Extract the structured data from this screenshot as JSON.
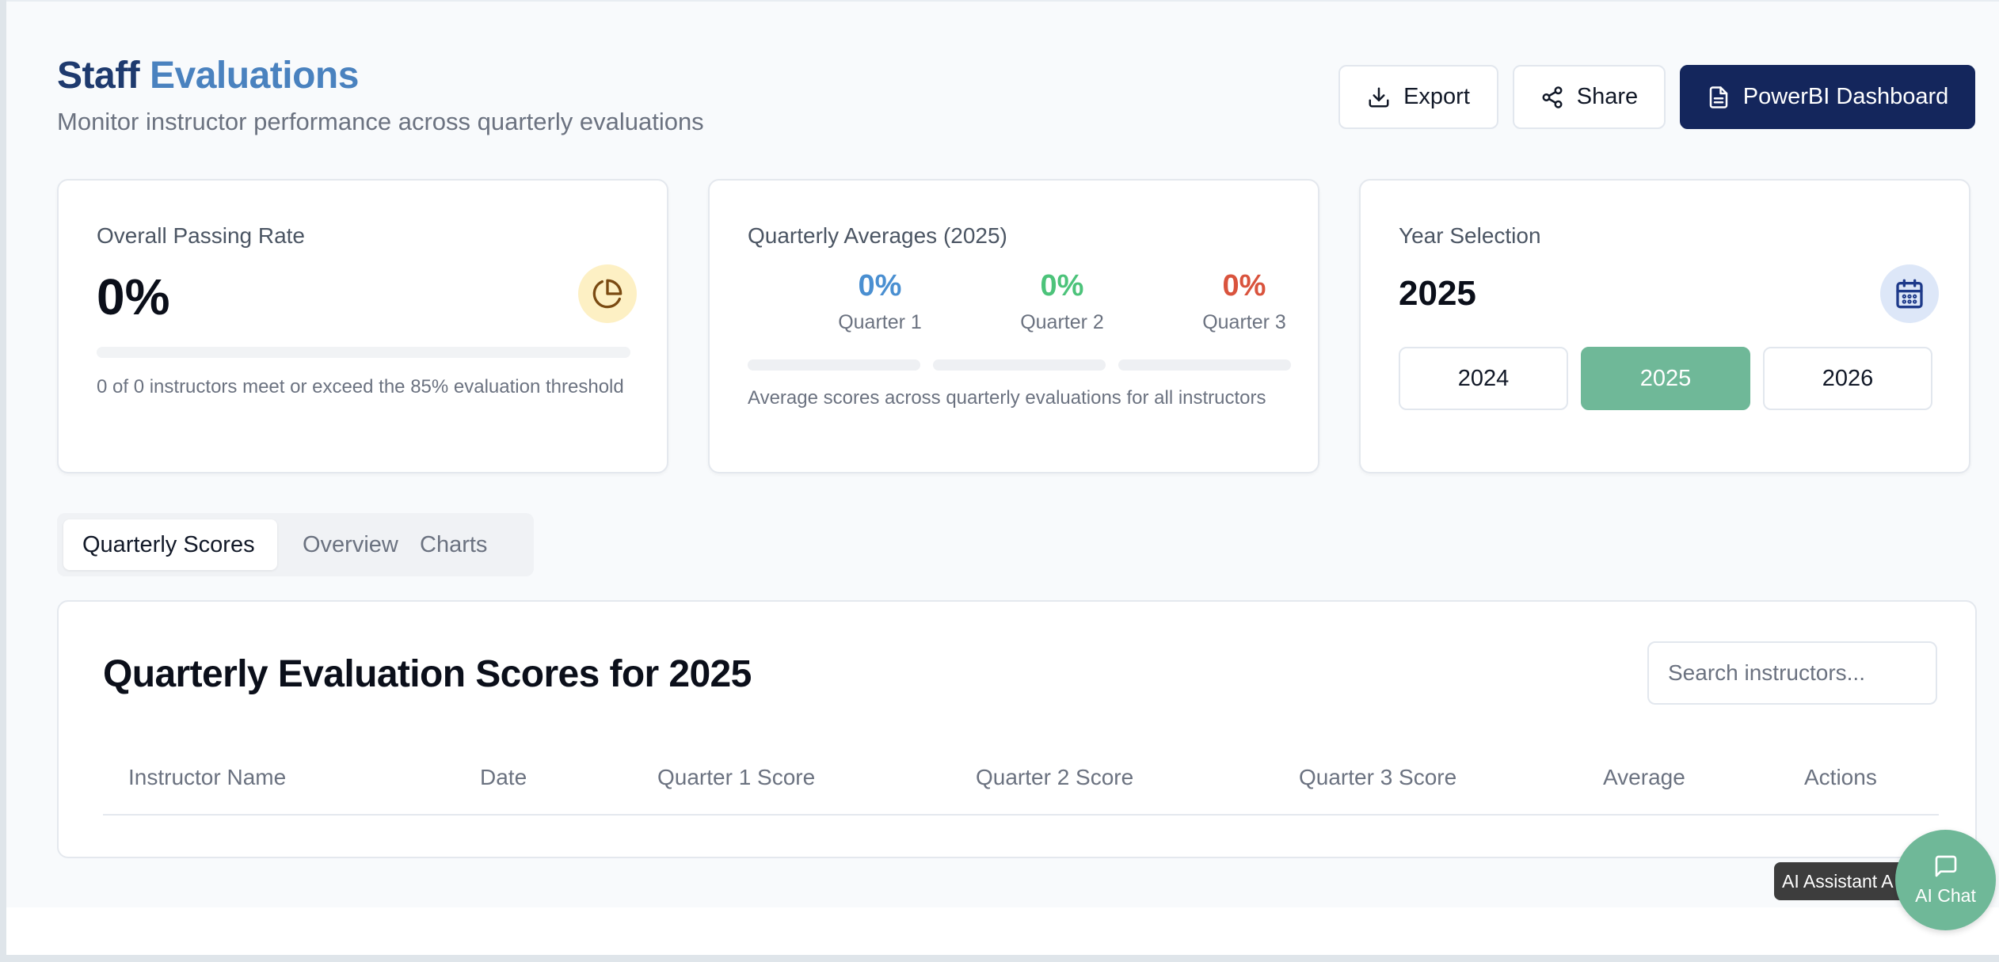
{
  "header": {
    "title_part1": "Staff",
    "title_part2": "Evaluations",
    "subtitle": "Monitor instructor performance across quarterly evaluations",
    "export_label": "Export",
    "share_label": "Share",
    "powerbi_label": "PowerBI Dashboard"
  },
  "passing_card": {
    "label": "Overall Passing Rate",
    "value": "0%",
    "progress_fraction": 0,
    "note": "0 of 0 instructors meet or exceed the 85% evaluation threshold",
    "icon": "pie-chart-icon"
  },
  "quarterly_card": {
    "label": "Quarterly Averages (2025)",
    "quarters": [
      {
        "value": "0%",
        "label": "Quarter 1",
        "fraction": 0,
        "color": "#4a8fd1"
      },
      {
        "value": "0%",
        "label": "Quarter 2",
        "fraction": 0,
        "color": "#4cc37a"
      },
      {
        "value": "0%",
        "label": "Quarter 3",
        "fraction": 0,
        "color": "#d9533d"
      }
    ],
    "note": "Average scores across quarterly evaluations for all instructors"
  },
  "year_card": {
    "label": "Year Selection",
    "value": "2025",
    "icon": "calendar-icon",
    "years": [
      "2024",
      "2025",
      "2026"
    ],
    "selected": "2025",
    "accent": "#6fb898"
  },
  "tabs": [
    {
      "label": "Quarterly Scores",
      "active": true
    },
    {
      "label": "Overview",
      "active": false
    },
    {
      "label": "Charts",
      "active": false
    }
  ],
  "table": {
    "title": "Quarterly Evaluation Scores for 2025",
    "search_placeholder": "Search instructors...",
    "columns": [
      "Instructor Name",
      "Date",
      "Quarter 1 Score",
      "Quarter 2 Score",
      "Quarter 3 Score",
      "Average",
      "Actions"
    ],
    "rows": []
  },
  "ai": {
    "tooltip": "AI Assistant A",
    "button_label": "AI Chat"
  },
  "colors": {
    "brand_dark": "#14265c",
    "title_dark": "#1e3a6e",
    "title_light": "#4a82bf",
    "accent_green": "#6fb898"
  }
}
